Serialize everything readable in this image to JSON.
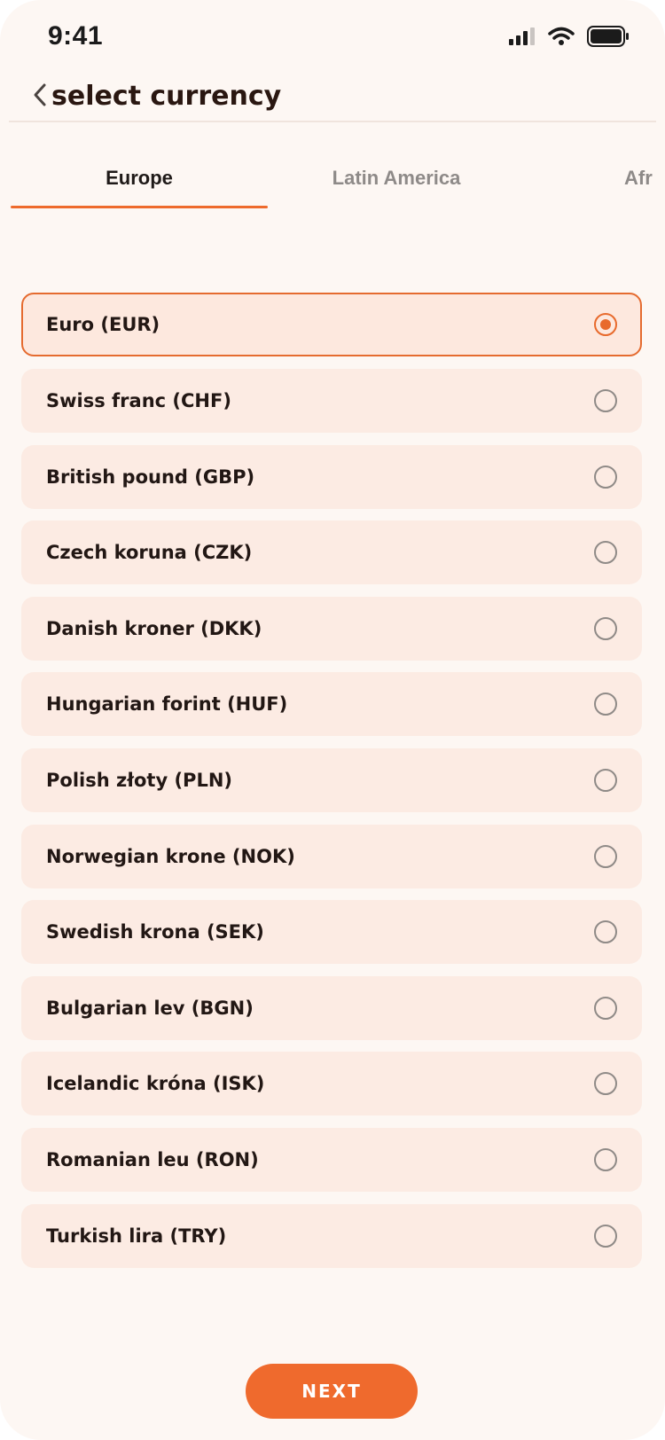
{
  "status_bar": {
    "time": "9:41",
    "icons": [
      "cellular-signal-icon",
      "wifi-icon",
      "battery-icon"
    ]
  },
  "header": {
    "back_icon": "chevron-left-icon",
    "title": "select currency"
  },
  "tabs": [
    {
      "label": "Europe",
      "active": true
    },
    {
      "label": "Latin America",
      "active": false
    },
    {
      "label": "Afr",
      "active": false
    }
  ],
  "currencies": [
    {
      "label": "Euro (EUR)",
      "selected": true
    },
    {
      "label": "Swiss franc (CHF)",
      "selected": false
    },
    {
      "label": "British pound (GBP)",
      "selected": false
    },
    {
      "label": "Czech koruna (CZK)",
      "selected": false
    },
    {
      "label": "Danish kroner (DKK)",
      "selected": false
    },
    {
      "label": "Hungarian forint (HUF)",
      "selected": false
    },
    {
      "label": "Polish złoty (PLN)",
      "selected": false
    },
    {
      "label": "Norwegian krone (NOK)",
      "selected": false
    },
    {
      "label": "Swedish krona (SEK)",
      "selected": false
    },
    {
      "label": "Bulgarian lev (BGN)",
      "selected": false
    },
    {
      "label": "Icelandic króna (ISK)",
      "selected": false
    },
    {
      "label": "Romanian leu (RON)",
      "selected": false
    },
    {
      "label": "Turkish lira (TRY)",
      "selected": false
    }
  ],
  "footer": {
    "next_label": "NEXT"
  },
  "colors": {
    "accent": "#ef6a2d",
    "background": "#fdf7f3",
    "item_background": "#fcebe3"
  }
}
